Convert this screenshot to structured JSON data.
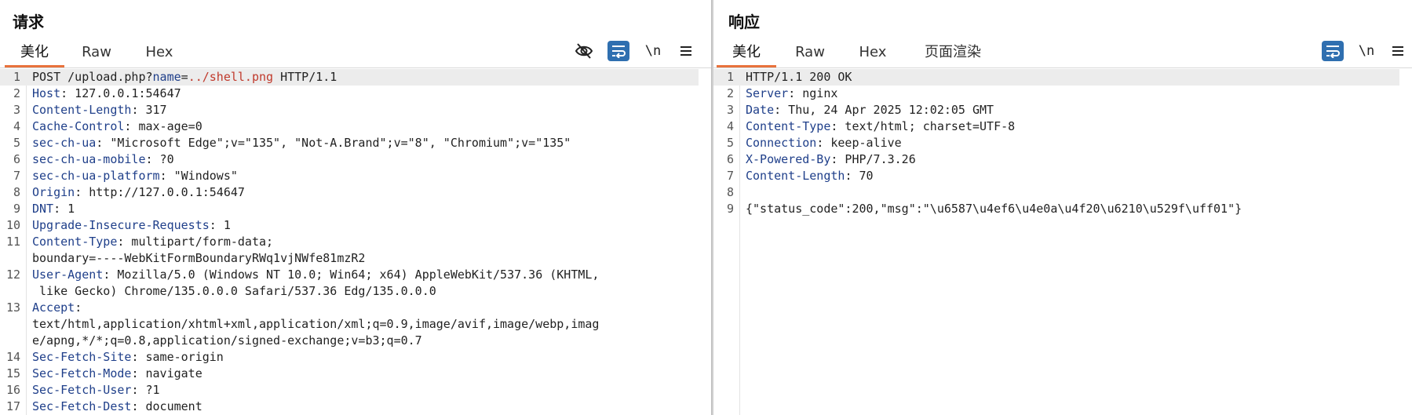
{
  "request": {
    "title": "请求",
    "tabs": [
      "美化",
      "Raw",
      "Hex"
    ],
    "active_tab": "美化",
    "toolbar": {
      "hide_icon": "eye-off-icon",
      "wrap_icon": "wrap-lines-icon",
      "newline_label": "\\n",
      "menu_icon": "hamburger-menu-icon"
    },
    "lines": [
      {
        "n": "1",
        "parts": [
          {
            "t": "POST /upload.php?",
            "c": "v"
          },
          {
            "t": "name",
            "c": "k"
          },
          {
            "t": "=",
            "c": "v"
          },
          {
            "t": "../shell.png",
            "c": "r"
          },
          {
            "t": " HTTP/1.1",
            "c": "v"
          }
        ]
      },
      {
        "n": "2",
        "parts": [
          {
            "t": "Host",
            "c": "k"
          },
          {
            "t": ": 127.0.0.1:54647",
            "c": "v"
          }
        ]
      },
      {
        "n": "3",
        "parts": [
          {
            "t": "Content-Length",
            "c": "k"
          },
          {
            "t": ": 317",
            "c": "v"
          }
        ]
      },
      {
        "n": "4",
        "parts": [
          {
            "t": "Cache-Control",
            "c": "k"
          },
          {
            "t": ": max-age=0",
            "c": "v"
          }
        ]
      },
      {
        "n": "5",
        "parts": [
          {
            "t": "sec-ch-ua",
            "c": "k"
          },
          {
            "t": ": \"Microsoft Edge\";v=\"135\", \"Not-A.Brand\";v=\"8\", \"Chromium\";v=\"135\"",
            "c": "v"
          }
        ]
      },
      {
        "n": "6",
        "parts": [
          {
            "t": "sec-ch-ua-mobile",
            "c": "k"
          },
          {
            "t": ": ?0",
            "c": "v"
          }
        ]
      },
      {
        "n": "7",
        "parts": [
          {
            "t": "sec-ch-ua-platform",
            "c": "k"
          },
          {
            "t": ": \"Windows\"",
            "c": "v"
          }
        ]
      },
      {
        "n": "8",
        "parts": [
          {
            "t": "Origin",
            "c": "k"
          },
          {
            "t": ": http://127.0.0.1:54647",
            "c": "v"
          }
        ]
      },
      {
        "n": "9",
        "parts": [
          {
            "t": "DNT",
            "c": "k"
          },
          {
            "t": ": 1",
            "c": "v"
          }
        ]
      },
      {
        "n": "10",
        "parts": [
          {
            "t": "Upgrade-Insecure-Requests",
            "c": "k"
          },
          {
            "t": ": 1",
            "c": "v"
          }
        ]
      },
      {
        "n": "11",
        "parts": [
          {
            "t": "Content-Type",
            "c": "k"
          },
          {
            "t": ": multipart/form-data;",
            "c": "v"
          }
        ],
        "cont": [
          "boundary=----WebKitFormBoundaryRWq1vjNWfe81mzR2"
        ]
      },
      {
        "n": "12",
        "parts": [
          {
            "t": "User-Agent",
            "c": "k"
          },
          {
            "t": ": Mozilla/5.0 (Windows NT 10.0; Win64; x64) AppleWebKit/537.36 (KHTML,",
            "c": "v"
          }
        ],
        "cont": [
          " like Gecko) Chrome/135.0.0.0 Safari/537.36 Edg/135.0.0.0"
        ]
      },
      {
        "n": "13",
        "parts": [
          {
            "t": "Accept",
            "c": "k"
          },
          {
            "t": ":",
            "c": "v"
          }
        ],
        "cont": [
          "text/html,application/xhtml+xml,application/xml;q=0.9,image/avif,image/webp,imag",
          "e/apng,*/*;q=0.8,application/signed-exchange;v=b3;q=0.7"
        ]
      },
      {
        "n": "14",
        "parts": [
          {
            "t": "Sec-Fetch-Site",
            "c": "k"
          },
          {
            "t": ": same-origin",
            "c": "v"
          }
        ]
      },
      {
        "n": "15",
        "parts": [
          {
            "t": "Sec-Fetch-Mode",
            "c": "k"
          },
          {
            "t": ": navigate",
            "c": "v"
          }
        ]
      },
      {
        "n": "16",
        "parts": [
          {
            "t": "Sec-Fetch-User",
            "c": "k"
          },
          {
            "t": ": ?1",
            "c": "v"
          }
        ]
      },
      {
        "n": "17",
        "parts": [
          {
            "t": "Sec-Fetch-Dest",
            "c": "k"
          },
          {
            "t": ": document",
            "c": "v"
          }
        ]
      }
    ]
  },
  "response": {
    "title": "响应",
    "tabs": [
      "美化",
      "Raw",
      "Hex",
      "页面渲染"
    ],
    "active_tab": "美化",
    "toolbar": {
      "wrap_icon": "wrap-lines-icon",
      "newline_label": "\\n",
      "menu_icon": "hamburger-menu-icon"
    },
    "lines": [
      {
        "n": "1",
        "parts": [
          {
            "t": "HTTP/1.1 200 OK",
            "c": "v"
          }
        ]
      },
      {
        "n": "2",
        "parts": [
          {
            "t": "Server",
            "c": "k"
          },
          {
            "t": ": nginx",
            "c": "v"
          }
        ]
      },
      {
        "n": "3",
        "parts": [
          {
            "t": "Date",
            "c": "k"
          },
          {
            "t": ": Thu, 24 Apr 2025 12:02:05 GMT",
            "c": "v"
          }
        ]
      },
      {
        "n": "4",
        "parts": [
          {
            "t": "Content-Type",
            "c": "k"
          },
          {
            "t": ": text/html; charset=UTF-8",
            "c": "v"
          }
        ]
      },
      {
        "n": "5",
        "parts": [
          {
            "t": "Connection",
            "c": "k"
          },
          {
            "t": ": keep-alive",
            "c": "v"
          }
        ]
      },
      {
        "n": "6",
        "parts": [
          {
            "t": "X-Powered-By",
            "c": "k"
          },
          {
            "t": ": PHP/7.3.26",
            "c": "v"
          }
        ]
      },
      {
        "n": "7",
        "parts": [
          {
            "t": "Content-Length",
            "c": "k"
          },
          {
            "t": ": 70",
            "c": "v"
          }
        ]
      },
      {
        "n": "8",
        "parts": []
      },
      {
        "n": "9",
        "parts": [
          {
            "t": "{\"status_code\":200,\"msg\":\"\\u6587\\u4ef6\\u4e0a\\u4f20\\u6210\\u529f\\uff01\"}",
            "c": "v"
          }
        ]
      }
    ]
  },
  "colors": {
    "accent_tab_underline": "#e8723c",
    "header_key": "#1f3f8a",
    "param_value": "#c0392b",
    "button_blue": "#2f6fb0"
  }
}
